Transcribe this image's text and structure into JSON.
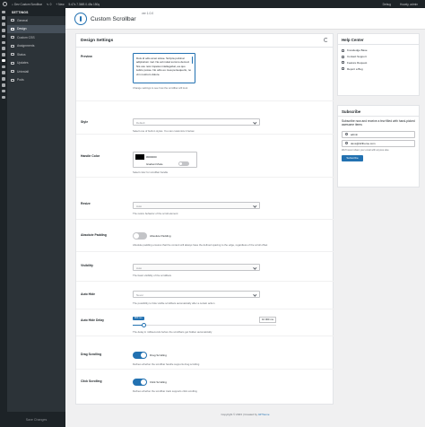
{
  "adminbar": {
    "site_name": "Dev Custom Scrollbar",
    "comments": "0",
    "new_label": "+ New",
    "stats": "5.47s  7.3MB  0.45s  150q",
    "debug_label": "Debug",
    "user_greeting": "Howdy, admin"
  },
  "sidebar": {
    "heading": "SETTINGS",
    "items": [
      "General",
      "Design",
      "Custom CSS",
      "Assignments",
      "Status",
      "Updates",
      "Uninstall",
      "Pods"
    ],
    "save_label": "Save Changes"
  },
  "header": {
    "title": "Custom Scrollbar",
    "version": "ver 1.0.0"
  },
  "panel": {
    "title": "Design Settings",
    "preview": {
      "label": "Preview",
      "text": "Duis id odio amet wisse. Scripta pulvinar adipisicum mel. Ne ad mutat summo demod. Nis usu nosi impetus intellegebat, ea quo iudico posse. No odio eu mea persequeris, no vim nostrum dolore.",
      "help": "Change settings to see how the scrollbar will look"
    },
    "style": {
      "label": "Style",
      "value": "Default",
      "help": "Select one of built-in styles. You can customize it below."
    },
    "handle_color": {
      "label": "Handle Color",
      "hex": "#000000",
      "gradient_label": "Gradient Mode",
      "help": "Select color for scrollbar handle"
    },
    "resize": {
      "label": "Resize",
      "value": "Auto",
      "help": "The resize behavior of the scroll element"
    },
    "absolute_padding": {
      "label": "Absolute Padding",
      "toggle_label": "Absolute Padding",
      "enabled": false,
      "help": "Absolute padding ensures that the content will always have the defined spacing to the edge, regardless of the scroll offset"
    },
    "visibility": {
      "label": "Visibility",
      "value": "Auto",
      "help": "The basic visibility of the scrollbars"
    },
    "auto_hide": {
      "label": "Auto Hide",
      "value": "Never",
      "help": "The possibility to hide visible scrollbars automatically after a certain action"
    },
    "auto_hide_delay": {
      "label": "Auto Hide Delay",
      "value_label": "800 ms",
      "max_label": "10 000 ms",
      "fraction": 0.08,
      "help": "The delay in milliseconds before the scrollbars get hidden automatically"
    },
    "drag_scrolling": {
      "label": "Drag Scrolling",
      "toggle_label": "Drag Scrolling",
      "enabled": true,
      "help": "Defines whether the scrollbar handle supports drag scrolling"
    },
    "click_scrolling": {
      "label": "Click Scrolling",
      "toggle_label": "Click Scrolling",
      "enabled": true,
      "help": "Defines whether the scrollbar track supports click scrolling"
    }
  },
  "footer": {
    "copyright": "Copyright © 2023 | Created by",
    "author": "42Theme"
  },
  "help_center": {
    "title": "Help Center",
    "links": [
      "Knowledge Base",
      "Contact Support",
      "Feature Request",
      "Report a Bug"
    ]
  },
  "subscribe": {
    "title": "Subscribe",
    "text": "Subscribe now and receive a few filled with hand-picked awesome items",
    "name_value": "admin",
    "email_value": "devs@42theme.com",
    "note": "We'll never share your email with anyone else",
    "button": "Subscribe"
  }
}
